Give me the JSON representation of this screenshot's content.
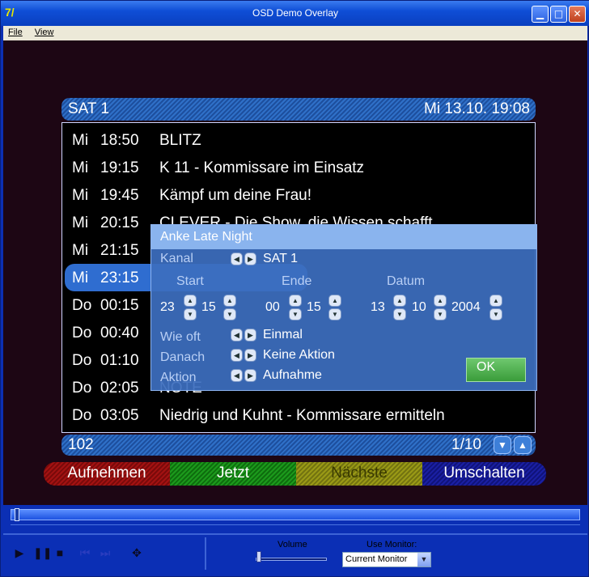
{
  "window": {
    "title": "OSD Demo Overlay",
    "app_icon": "7/"
  },
  "titlebar_buttons": {
    "minimize": "▁",
    "maximize": "□",
    "close": "✕"
  },
  "menu": [
    "File",
    "View"
  ],
  "epg": {
    "channel": "SAT 1",
    "datetime": "Mi 13.10. 19:08",
    "rows": [
      {
        "day": "Mi",
        "time": "18:50",
        "title": "BLITZ"
      },
      {
        "day": "Mi",
        "time": "19:15",
        "title": "K 11 - Kommissare im Einsatz"
      },
      {
        "day": "Mi",
        "time": "19:45",
        "title": "Kämpf um deine Frau!"
      },
      {
        "day": "Mi",
        "time": "20:15",
        "title": "CLEVER - Die Show, die Wissen schafft"
      },
      {
        "day": "Mi",
        "time": "21:15",
        "title": ""
      },
      {
        "day": "Mi",
        "time": "23:15",
        "title": ""
      },
      {
        "day": "Do",
        "time": "00:15",
        "title": ""
      },
      {
        "day": "Do",
        "time": "00:40",
        "title": ""
      },
      {
        "day": "Do",
        "time": "01:10",
        "title": ""
      },
      {
        "day": "Do",
        "time": "02:05",
        "title": "NOTE"
      },
      {
        "day": "Do",
        "time": "03:05",
        "title": "Niedrig und Kuhnt - Kommissare ermitteln"
      }
    ],
    "footer_left": "102",
    "footer_page": "1/10",
    "arrow_down": "▼",
    "arrow_up": "▲"
  },
  "color_buttons": {
    "red": "Aufnehmen",
    "green": "Jetzt",
    "yellow": "Nächste",
    "blue": "Umschalten"
  },
  "dialog": {
    "title": "Anke Late Night",
    "kanal_label": "Kanal",
    "kanal_value": "SAT 1",
    "start_label": "Start",
    "ende_label": "Ende",
    "datum_label": "Datum",
    "start_h": "23",
    "start_m": "15",
    "ende_h": "00",
    "ende_m": "15",
    "datum_d": "13",
    "datum_mo": "10",
    "datum_y": "2004",
    "wieoft_label": "Wie oft",
    "wieoft_value": "Einmal",
    "danach_label": "Danach",
    "danach_value": "Keine Aktion",
    "aktion_label": "Aktion",
    "aktion_value": "Aufnahme",
    "ok": "OK"
  },
  "player": {
    "play": "▶",
    "pause": "❚❚",
    "stop": "■",
    "prev": "⏮",
    "next": "⏭",
    "pan": "✥",
    "volume_label": "Volume",
    "monitor_label": "Use Monitor:",
    "monitor_value": "Current Monitor",
    "monitor_dd": "▼"
  }
}
